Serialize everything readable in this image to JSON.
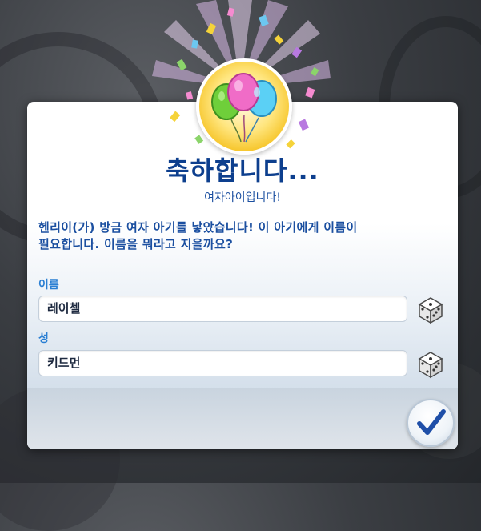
{
  "dialog": {
    "title": "축하합니다...",
    "subtitle": "여자아이입니다!",
    "message_line1": "헨리이(가) 방금 여자 아기를 낳았습니다! 이 아기에게 이름이",
    "message_line2": "필요합니다. 이름을 뭐라고 지을까요?",
    "first_name": {
      "label": "이름",
      "value": "레이첼"
    },
    "last_name": {
      "label": "성",
      "value": "키드먼"
    },
    "confirm_icon": "checkmark-icon",
    "randomize_icon": "dice-icon",
    "badge_icon": "balloons-icon"
  },
  "colors": {
    "title": "#0d3f8e",
    "label": "#2a7fd3",
    "confirm_check": "#1f4fa8"
  }
}
